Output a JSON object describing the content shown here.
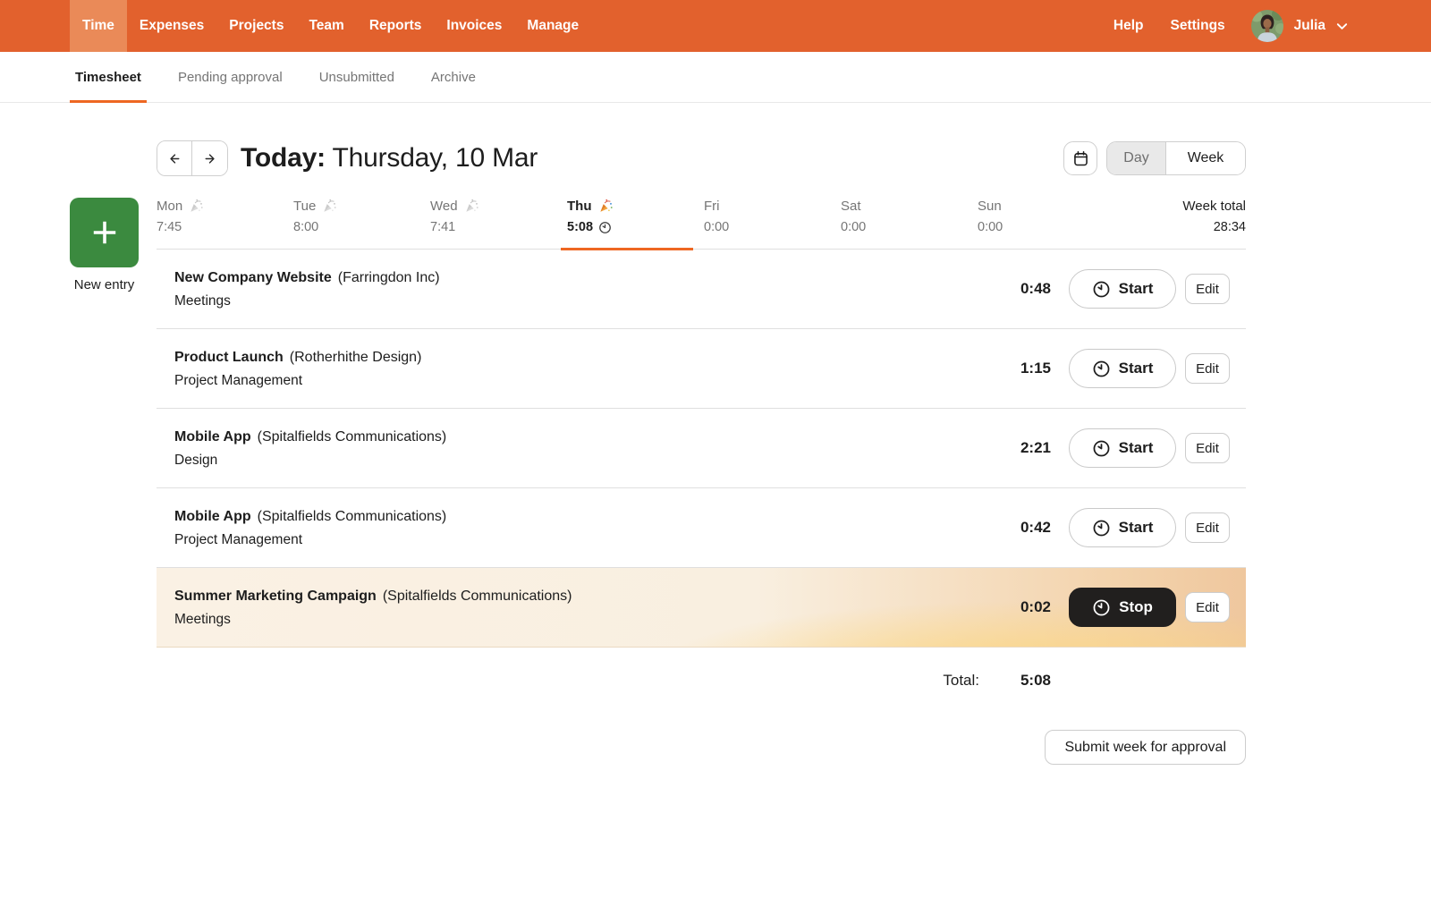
{
  "colors": {
    "brand_orange": "#E2612D",
    "brand_orange_active": "#EA8A58",
    "accent_orange": "#EE6722",
    "new_entry_green": "#3B8A3F",
    "timer_button_dark": "#211F1E",
    "running_row_gradient_left": "#FAF1E4",
    "running_row_gradient_right": "#EFC79E"
  },
  "top_nav": {
    "items": [
      {
        "label": "Time",
        "active": true
      },
      {
        "label": "Expenses",
        "active": false
      },
      {
        "label": "Projects",
        "active": false
      },
      {
        "label": "Team",
        "active": false
      },
      {
        "label": "Reports",
        "active": false
      },
      {
        "label": "Invoices",
        "active": false
      },
      {
        "label": "Manage",
        "active": false
      }
    ],
    "help_label": "Help",
    "settings_label": "Settings",
    "user_name": "Julia",
    "avatar_icon": "user-avatar",
    "user_chevron_icon": "chevron-down-icon"
  },
  "sub_nav": {
    "tabs": [
      {
        "label": "Timesheet",
        "active": true
      },
      {
        "label": "Pending approval",
        "active": false
      },
      {
        "label": "Unsubmitted",
        "active": false
      },
      {
        "label": "Archive",
        "active": false
      }
    ]
  },
  "header": {
    "today_label": "Today:",
    "date_label": "Thursday, 10 Mar",
    "prev_icon": "arrow-left-icon",
    "next_icon": "arrow-right-icon",
    "calendar_icon": "calendar-icon",
    "day_label": "Day",
    "week_label": "Week",
    "active_view": "Day"
  },
  "new_entry": {
    "label": "New entry",
    "plus_icon": "plus-icon"
  },
  "week": {
    "days": [
      {
        "name": "Mon",
        "time": "7:45",
        "celebration_icon": "party-popper-icon",
        "icon_gray": true,
        "active": false,
        "timer_running": false
      },
      {
        "name": "Tue",
        "time": "8:00",
        "celebration_icon": "party-popper-icon",
        "icon_gray": true,
        "active": false,
        "timer_running": false
      },
      {
        "name": "Wed",
        "time": "7:41",
        "celebration_icon": "party-popper-icon",
        "icon_gray": true,
        "active": false,
        "timer_running": false
      },
      {
        "name": "Thu",
        "time": "5:08",
        "celebration_icon": "party-popper-icon",
        "icon_gray": false,
        "active": true,
        "timer_running": true,
        "running_icon": "clock-icon"
      },
      {
        "name": "Fri",
        "time": "0:00",
        "active": false,
        "timer_running": false
      },
      {
        "name": "Sat",
        "time": "0:00",
        "active": false,
        "timer_running": false
      },
      {
        "name": "Sun",
        "time": "0:00",
        "active": false,
        "timer_running": false
      }
    ],
    "total_label": "Week total",
    "total_value": "28:34"
  },
  "entries": [
    {
      "project": "New Company Website",
      "client": "(Farringdon Inc)",
      "task": "Meetings",
      "time": "0:48",
      "action_label": "Start",
      "edit_label": "Edit",
      "running": false
    },
    {
      "project": "Product Launch",
      "client": "(Rotherhithe Design)",
      "task": "Project Management",
      "time": "1:15",
      "action_label": "Start",
      "edit_label": "Edit",
      "running": false
    },
    {
      "project": "Mobile App",
      "client": "(Spitalfields Communications)",
      "task": "Design",
      "time": "2:21",
      "action_label": "Start",
      "edit_label": "Edit",
      "running": false
    },
    {
      "project": "Mobile App",
      "client": "(Spitalfields Communications)",
      "task": "Project Management",
      "time": "0:42",
      "action_label": "Start",
      "edit_label": "Edit",
      "running": false
    },
    {
      "project": "Summer Marketing Campaign",
      "client": "(Spitalfields Communications)",
      "task": "Meetings",
      "time": "0:02",
      "action_label": "Stop",
      "edit_label": "Edit",
      "running": true
    }
  ],
  "total": {
    "label": "Total:",
    "value": "5:08"
  },
  "submit_label": "Submit week for approval"
}
